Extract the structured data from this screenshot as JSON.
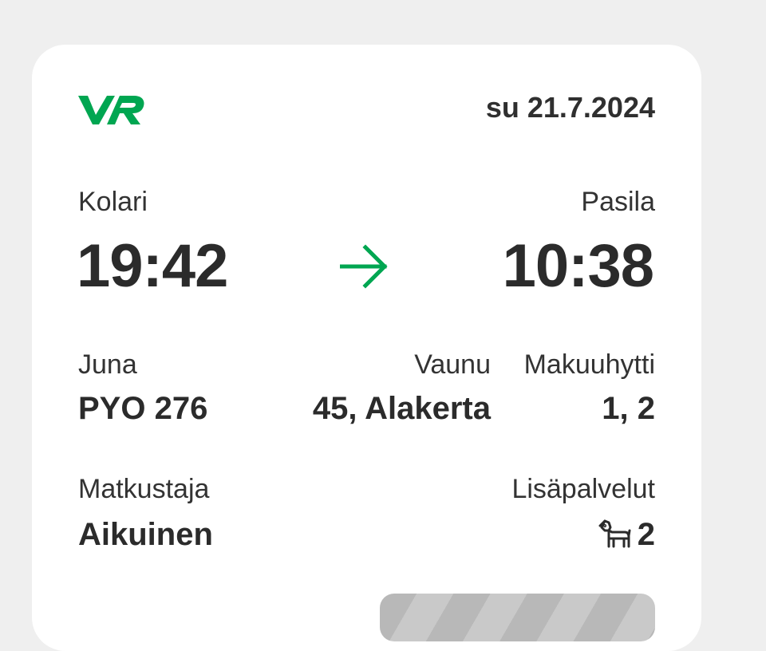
{
  "ticket": {
    "logo_text": "VR",
    "date": "su 21.7.2024",
    "from": {
      "station": "Kolari",
      "time": "19:42"
    },
    "to": {
      "station": "Pasila",
      "time": "10:38"
    },
    "train": {
      "label": "Juna",
      "value": "PYO 276"
    },
    "car": {
      "label": "Vaunu",
      "value": "45, Alakerta"
    },
    "cabin": {
      "label": "Makuuhytti",
      "value": "1, 2"
    },
    "passenger": {
      "label": "Matkustaja",
      "value": "Aikuinen"
    },
    "extras": {
      "label": "Lisäpalvelut",
      "icon": "dog-icon",
      "count": "2"
    }
  },
  "colors": {
    "brand_green": "#00A651",
    "text": "#2b2b2b",
    "background": "#efefef",
    "card": "#ffffff"
  }
}
